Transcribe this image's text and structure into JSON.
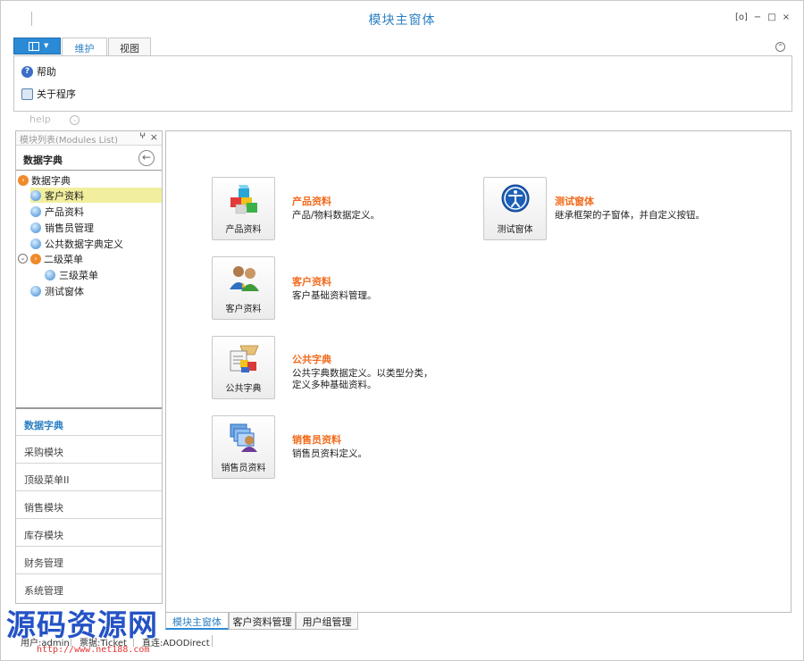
{
  "window": {
    "title": "模块主窗体",
    "controls": [
      "[o]",
      "−",
      "□",
      "×"
    ]
  },
  "ribbon": {
    "tabs": [
      "维护",
      "视图"
    ],
    "active_tab": "维护",
    "items": [
      {
        "label": "帮助",
        "icon": "help-icon"
      },
      {
        "label": "关于程序",
        "icon": "about-icon"
      }
    ],
    "collapse_icon": "chevron-up-icon",
    "help_label": "help"
  },
  "left_panel": {
    "header": "模块列表(Modules List)",
    "pin": "ⵖ",
    "close": "×",
    "title": "数据字典",
    "back_icon": "back-arrow-icon",
    "tree": [
      {
        "label": "数据字典",
        "level": 0,
        "type": "group"
      },
      {
        "label": "客户资料",
        "level": 1,
        "type": "leaf",
        "selected": true
      },
      {
        "label": "产品资料",
        "level": 1,
        "type": "leaf"
      },
      {
        "label": "销售员管理",
        "level": 1,
        "type": "leaf"
      },
      {
        "label": "公共数据字典定义",
        "level": 1,
        "type": "leaf"
      },
      {
        "label": "二级菜单",
        "level": 0,
        "type": "group-expander"
      },
      {
        "label": "三级菜单",
        "level": 2,
        "type": "leaf"
      },
      {
        "label": "测试窗体",
        "level": 1,
        "type": "leaf"
      }
    ],
    "nav_groups": [
      "数据字典",
      "采购模块",
      "顶级菜单II",
      "销售模块",
      "库存模块",
      "财务管理",
      "系统管理"
    ],
    "active_group": "数据字典"
  },
  "main": {
    "modules": [
      {
        "tile_label": "产品资料",
        "title": "产品资料",
        "desc": "产品/物料数据定义。",
        "icon": "cubes-icon"
      },
      {
        "tile_label": "客户资料",
        "title": "客户资料",
        "desc": "客户基础资料管理。",
        "icon": "users-icon"
      },
      {
        "tile_label": "公共字典",
        "title": "公共字典",
        "desc": "公共字典数据定义。以类型分类，",
        "desc2": "定义多种基础资料。",
        "icon": "dictionary-icon"
      },
      {
        "tile_label": "销售员资料",
        "title": "销售员资料",
        "desc": "销售员资料定义。",
        "icon": "salesperson-icon"
      },
      {
        "tile_label": "测试窗体",
        "title": "测试窗体",
        "desc": "继承框架的子窗体，并自定义按钮。",
        "icon": "accessibility-icon"
      }
    ]
  },
  "doc_tabs": [
    "模块主窗体",
    "客户资料管理",
    "用户组管理"
  ],
  "active_doc_tab": "模块主窗体",
  "status": {
    "user": "用户:admin",
    "ticket": "票据:Ticket",
    "direct": "直连:ADODirect"
  },
  "watermark": {
    "text": "源码资源网",
    "url": "http://www.net188.com"
  }
}
